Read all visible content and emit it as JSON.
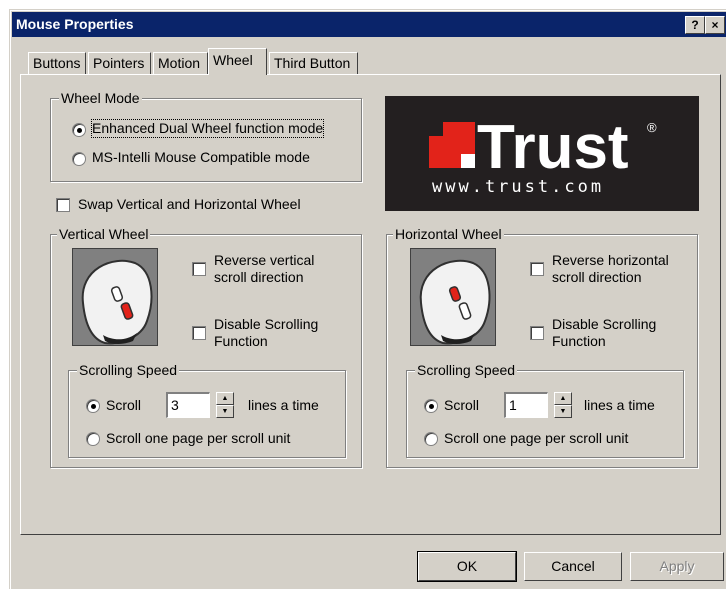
{
  "window": {
    "title": "Mouse Properties",
    "help_label": "?",
    "close_label": "×"
  },
  "tabs": [
    {
      "label": "Buttons"
    },
    {
      "label": "Pointers"
    },
    {
      "label": "Motion"
    },
    {
      "label": "Wheel",
      "active": true
    },
    {
      "label": "Third Button"
    }
  ],
  "wheel_mode": {
    "legend": "Wheel Mode",
    "option_enhanced": "Enhanced Dual Wheel function mode",
    "option_msintelli": "MS-Intelli Mouse Compatible mode",
    "selected": "Enhanced Dual Wheel function mode"
  },
  "logo": {
    "brand": "Trust",
    "url": "www.trust.com",
    "registered": "®"
  },
  "swap": {
    "label": "Swap Vertical and Horizontal Wheel",
    "checked": false
  },
  "vertical": {
    "legend": "Vertical Wheel",
    "reverse_line1": "Reverse vertical",
    "reverse_line2": "scroll direction",
    "reverse_checked": false,
    "disable_line1": "Disable Scrolling",
    "disable_line2": "Function",
    "disable_checked": false,
    "speed": {
      "legend": "Scrolling Speed",
      "scroll_label": "Scroll",
      "value": "3",
      "lines_label": "lines a time",
      "page_label": "Scroll one page per scroll unit",
      "selected": "Scroll"
    }
  },
  "horizontal": {
    "legend": "Horizontal Wheel",
    "reverse_line1": "Reverse horizontal",
    "reverse_line2": "scroll direction",
    "reverse_checked": false,
    "disable_line1": "Disable Scrolling",
    "disable_line2": "Function",
    "disable_checked": false,
    "speed": {
      "legend": "Scrolling Speed",
      "scroll_label": "Scroll",
      "value": "1",
      "lines_label": "lines a time",
      "page_label": "Scroll one page per scroll unit",
      "selected": "Scroll"
    }
  },
  "buttons": {
    "ok": "OK",
    "cancel": "Cancel",
    "apply": "Apply"
  },
  "colors": {
    "titlebar": "#0a246a",
    "face": "#d4d0c8",
    "logo_red": "#e2231a",
    "logo_bg": "#231f20"
  }
}
